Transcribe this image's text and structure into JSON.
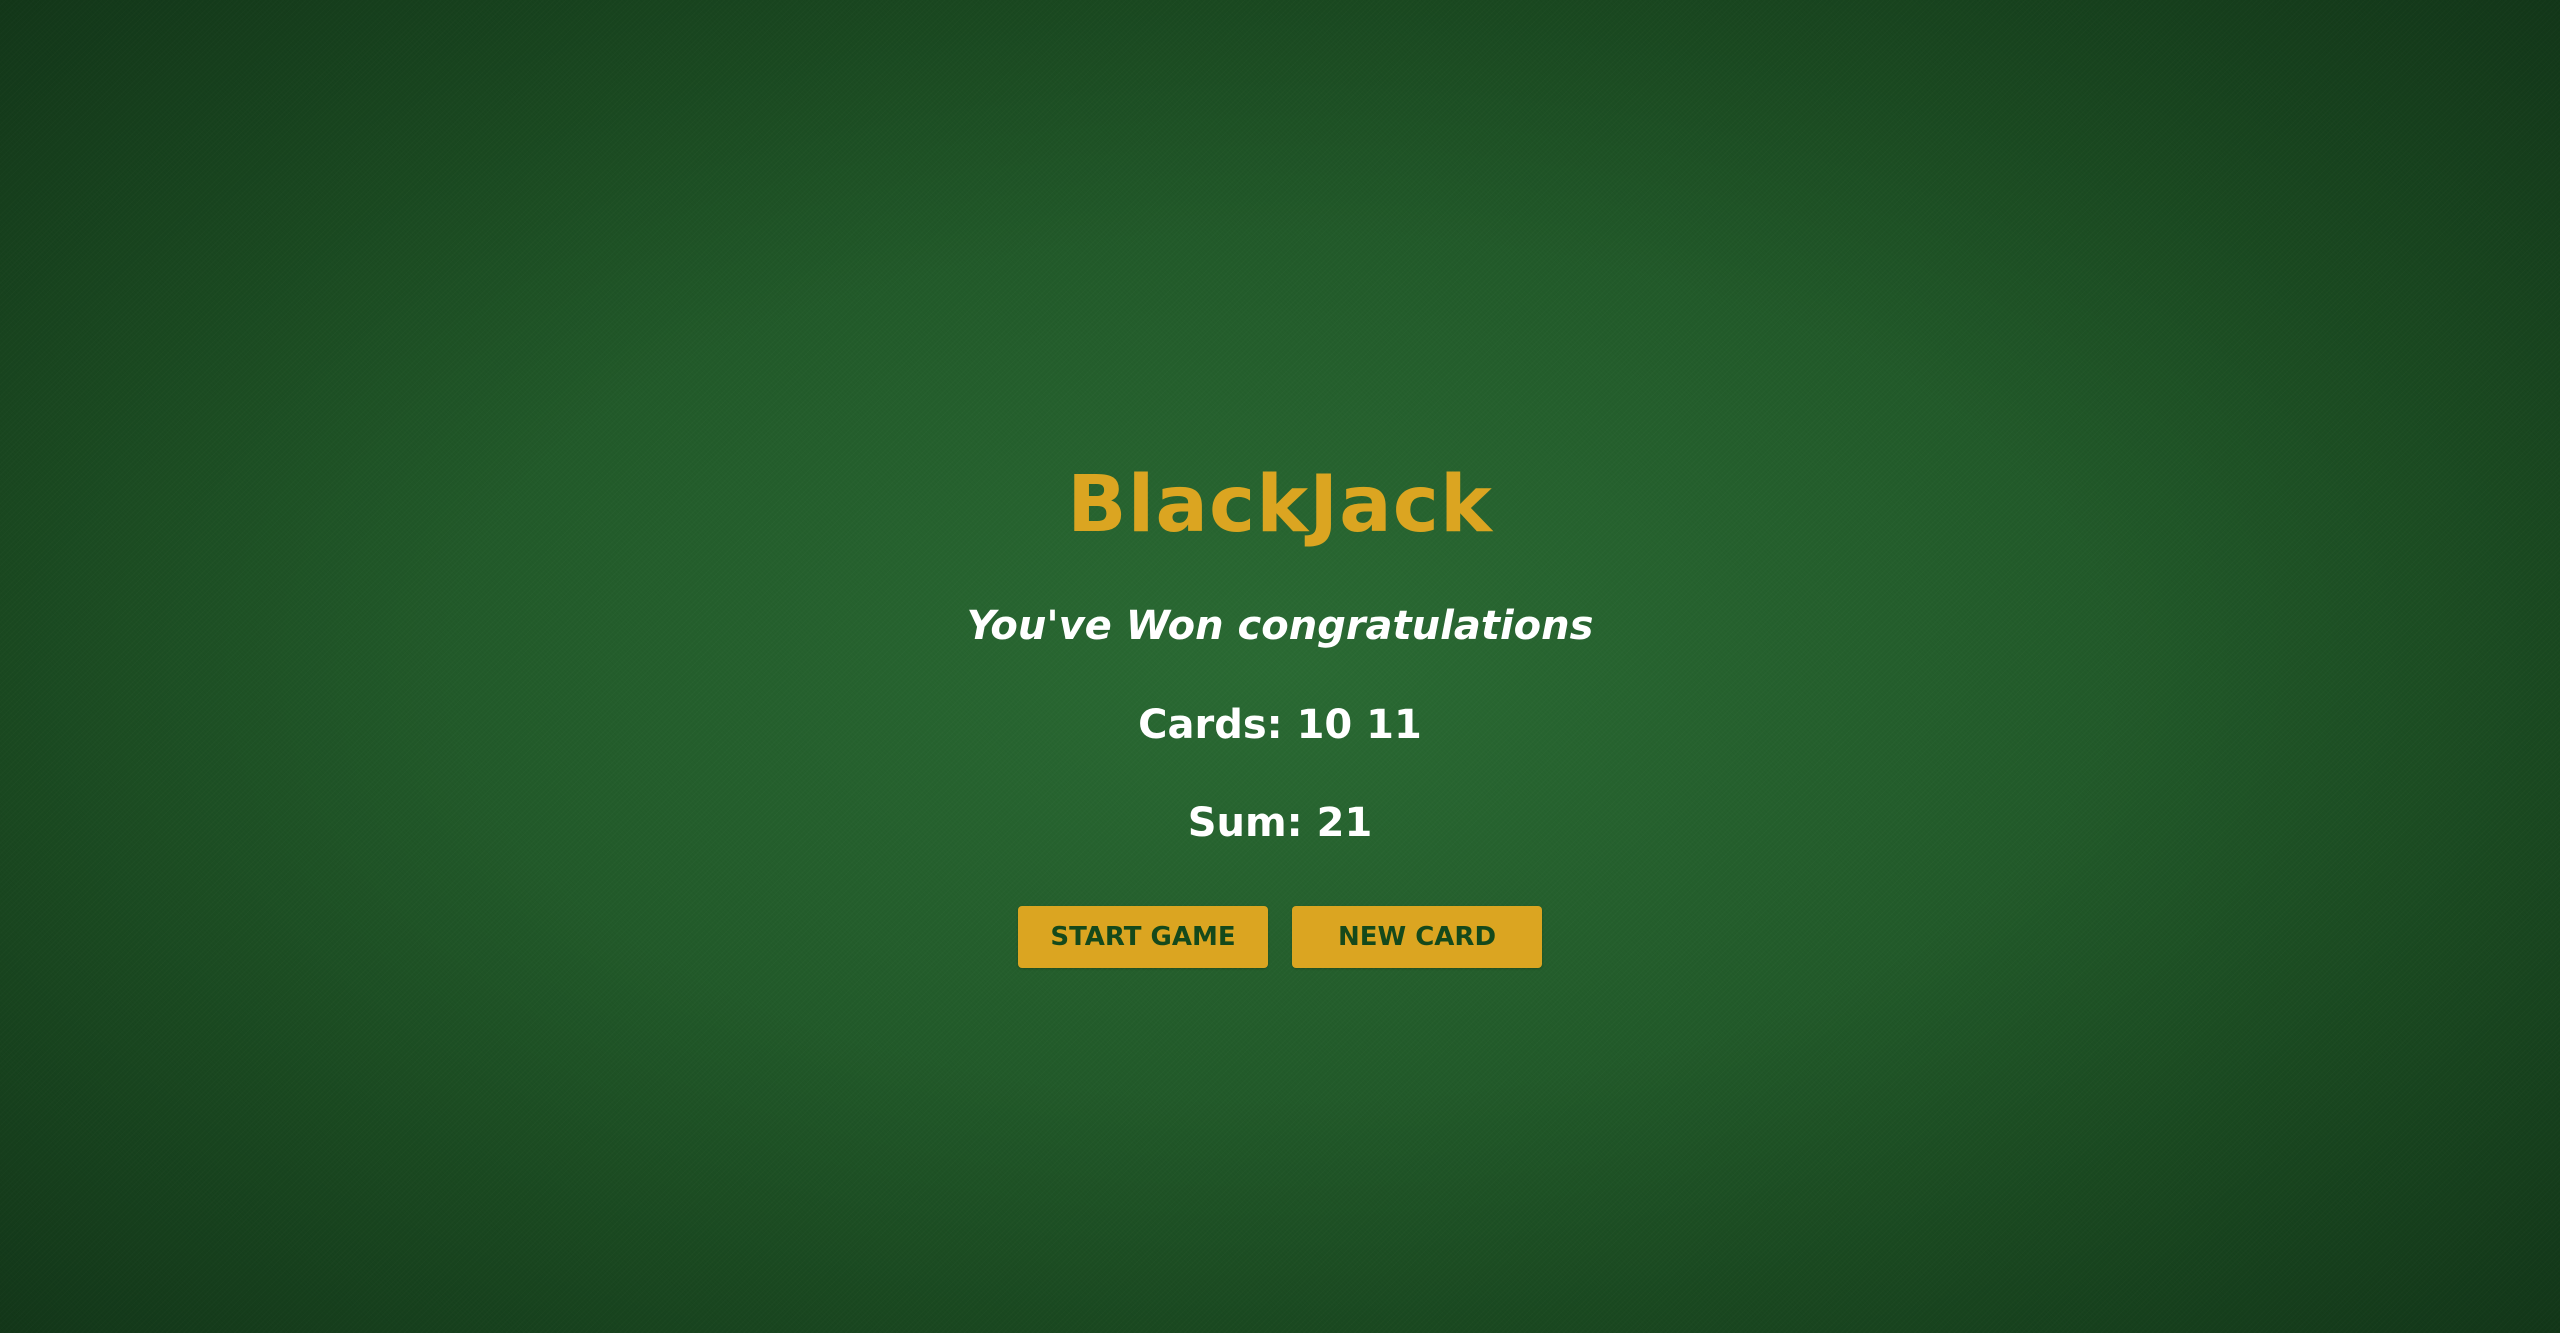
{
  "game": {
    "title": "BlackJack",
    "message": "You've Won congratulations",
    "cards_text": "Cards: 10 11",
    "sum_text": "Sum: 21",
    "cards": [
      10,
      11
    ],
    "sum": 21
  },
  "buttons": {
    "start_label": "START GAME",
    "new_card_label": "NEW CARD"
  },
  "colors": {
    "felt": "#245e2c",
    "accent": "#dba521",
    "button_text": "#15491b",
    "text": "#ffffff"
  }
}
